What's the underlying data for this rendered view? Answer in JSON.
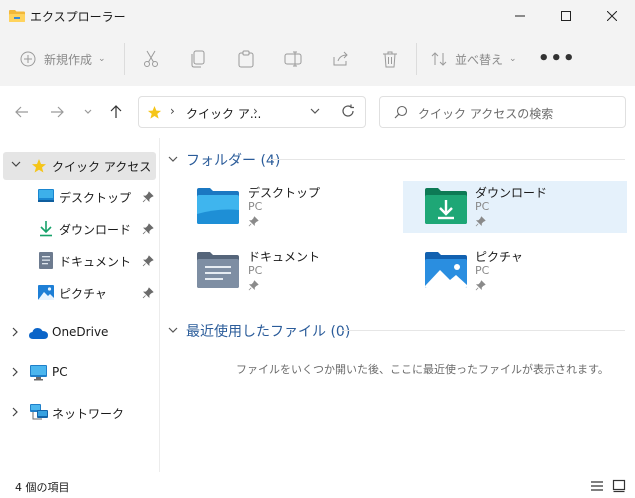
{
  "window": {
    "title": "エクスプローラー"
  },
  "toolbar": {
    "new_label": "新規作成",
    "sort_label": "並べ替え",
    "more_label": "•••"
  },
  "address": {
    "path_label": "クイック ア...",
    "sep": "›"
  },
  "search": {
    "placeholder": "クイック アクセスの検索"
  },
  "sidebar": {
    "items": [
      {
        "label": "クイック アクセス",
        "icon": "star-icon"
      },
      {
        "label": "デスクトップ",
        "icon": "desktop-icon"
      },
      {
        "label": "ダウンロード",
        "icon": "download-icon"
      },
      {
        "label": "ドキュメント",
        "icon": "document-icon"
      },
      {
        "label": "ピクチャ",
        "icon": "picture-icon"
      },
      {
        "label": "OneDrive",
        "icon": "cloud-icon"
      },
      {
        "label": "PC",
        "icon": "pc-icon"
      },
      {
        "label": "ネットワーク",
        "icon": "network-icon"
      }
    ]
  },
  "folders_section": {
    "title": "フォルダー (4)",
    "items": [
      {
        "name": "デスクトップ",
        "sub": "PC",
        "icon": "desktop-folder-icon"
      },
      {
        "name": "ダウンロード",
        "sub": "PC",
        "icon": "download-folder-icon"
      },
      {
        "name": "ドキュメント",
        "sub": "PC",
        "icon": "documents-folder-icon"
      },
      {
        "name": "ピクチャ",
        "sub": "PC",
        "icon": "pictures-folder-icon"
      }
    ]
  },
  "recent_section": {
    "title": "最近使用したファイル (0)",
    "empty_message": "ファイルをいくつか開いた後、ここに最近使ったファイルが表示されます。"
  },
  "status": {
    "item_count": "4 個の項目"
  },
  "colors": {
    "accent": "#0067c0",
    "section_header": "#2b5c9a",
    "selected_bg": "#e5e5e5",
    "tile_selected_bg": "#e5f1fb"
  }
}
